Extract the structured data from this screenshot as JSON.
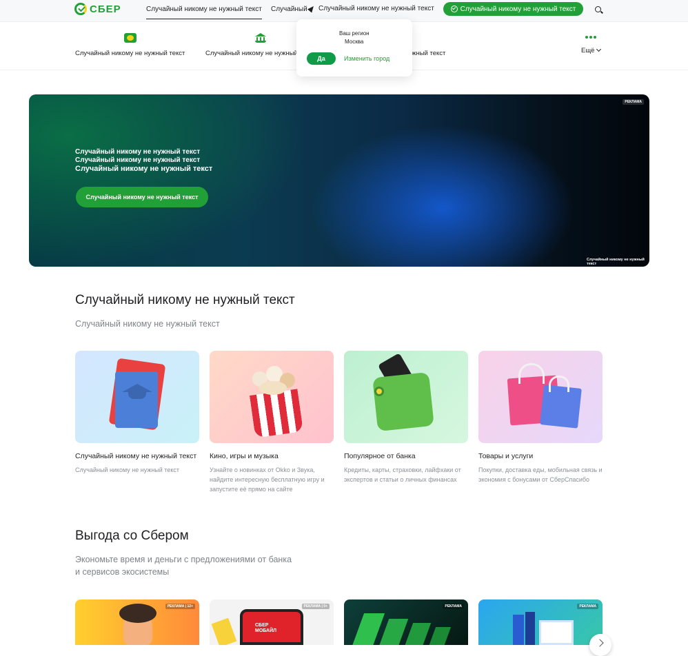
{
  "header": {
    "logo_text": "СБЕР",
    "nav_link_active": "Случайный никому не нужный текст",
    "nav_link_2": "Случайный",
    "region_link": "Случайный никому не нужный текст",
    "cta_button": "Случайный никому не нужный текст"
  },
  "categories": [
    {
      "label": "Случайный никому не нужный текст",
      "icon": "card-icon"
    },
    {
      "label": "Случайный никому не нужный текст",
      "icon": "bank-icon"
    },
    {
      "label": "Случайный никому не нужный текст",
      "icon": "hidden"
    },
    {
      "label": "Ещё",
      "icon": "more-dots-icon"
    }
  ],
  "region_popup": {
    "label": "Ваш регион",
    "city": "Москва",
    "yes": "Да",
    "change": "Изменить город"
  },
  "banner": {
    "ad_label": "РЕКЛАМА",
    "lines": [
      "Случайный никому не нужный текст",
      "Случайный никому не нужный текст",
      "Случайный никому не нужный текст"
    ],
    "button": "Случайный никому не нужный текст",
    "footnote": "Случайный никому не нужный текст"
  },
  "section1": {
    "title": "Случайный никому не нужный текст",
    "subtitle": "Случайный никому не нужный текст",
    "cards": [
      {
        "title": "Случайный никому не нужный текст",
        "desc": "Случайный никому не нужный текст",
        "icon": "graduation-book-icon"
      },
      {
        "title": "Кино, игры и музыка",
        "desc": "Узнайте о новинках от Okko и Звука, найдите интересную бесплатную игру и запустите её прямо на сайте",
        "icon": "popcorn-icon"
      },
      {
        "title": "Популярное от банка",
        "desc": "Кредиты, карты, страховки, лайфхаки от экспертов и статьи о личных финансах",
        "icon": "wallet-icon"
      },
      {
        "title": "Товары и услуги",
        "desc": "Покупки, доставка еды, мобильная связь и экономия с бонусами от СберСпасибо",
        "icon": "shopping-bags-icon"
      }
    ]
  },
  "section2": {
    "title": "Выгода со Сбером",
    "subtitle": "Экономьте время и деньги с предложениями от банка\nи сервисов экосистемы",
    "promos": [
      {
        "ad_label": "РЕКЛАМА | 12+"
      },
      {
        "ad_label": "РЕКЛАМА | 0+",
        "brand": "СБЕР\nМОБАЙЛ"
      },
      {
        "ad_label": "РЕКЛАМА"
      },
      {
        "ad_label": "РЕКЛАМА"
      }
    ]
  },
  "colors": {
    "brand_green": "#21a038",
    "text": "#1f1f22",
    "muted": "#7d838a"
  }
}
